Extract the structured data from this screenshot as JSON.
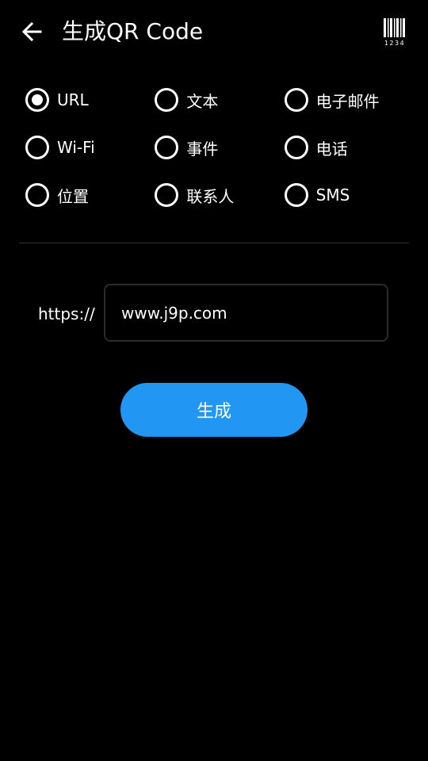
{
  "header": {
    "title": "生成QR Code",
    "barcode_digits": "1234"
  },
  "types": {
    "rows": [
      [
        {
          "label": "URL",
          "checked": true
        },
        {
          "label": "文本",
          "checked": false
        },
        {
          "label": "电子邮件",
          "checked": false
        }
      ],
      [
        {
          "label": "Wi-Fi",
          "checked": false
        },
        {
          "label": "事件",
          "checked": false
        },
        {
          "label": "电话",
          "checked": false
        }
      ],
      [
        {
          "label": "位置",
          "checked": false
        },
        {
          "label": "联系人",
          "checked": false
        },
        {
          "label": "SMS",
          "checked": false
        }
      ]
    ]
  },
  "form": {
    "prefix": "https://",
    "url_value": "www.j9p.com"
  },
  "actions": {
    "generate_label": "生成"
  },
  "colors": {
    "accent": "#2196f3",
    "background": "#000000",
    "text": "#ffffff"
  }
}
